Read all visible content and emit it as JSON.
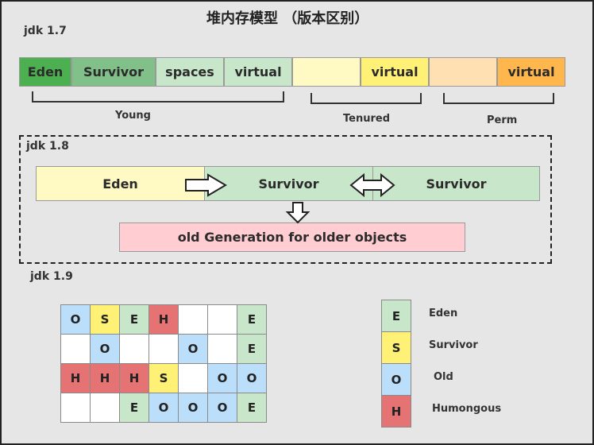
{
  "title": "堆内存模型 （版本区别）",
  "jdk17": {
    "label": "jdk 1.7",
    "segments": [
      {
        "text": "Eden",
        "color": "#4caf50"
      },
      {
        "text": "Survivor",
        "color": "#82c08a"
      },
      {
        "text": "spaces",
        "color": "#c8e6c9"
      },
      {
        "text": "virtual",
        "color": "#c8e6c9"
      },
      {
        "text": "",
        "color": "#fff9c4"
      },
      {
        "text": "virtual",
        "color": "#fff176"
      },
      {
        "text": "",
        "color": "#ffe0b2"
      },
      {
        "text": "virtual",
        "color": "#ffb74d"
      }
    ],
    "groups": [
      "Young",
      "Tenured",
      "Perm"
    ]
  },
  "jdk18": {
    "label": "jdk 1.8",
    "eden": "Eden",
    "survivor1": "Survivor",
    "survivor2": "Survivor",
    "old": "old Generation for older objects"
  },
  "jdk19": {
    "label": "jdk 1.9",
    "grid": [
      [
        "O",
        "S",
        "E",
        "H",
        "",
        "",
        "E"
      ],
      [
        "",
        "O",
        "",
        "",
        "O",
        "",
        "E"
      ],
      [
        "H",
        "H",
        "H",
        "S",
        "",
        "O",
        "O"
      ],
      [
        "",
        "",
        "E",
        "O",
        "O",
        "O",
        "E"
      ]
    ],
    "legend": [
      {
        "letter": "E",
        "name": "Eden"
      },
      {
        "letter": "S",
        "name": "Survivor"
      },
      {
        "letter": "O",
        "name": "Old"
      },
      {
        "letter": "H",
        "name": "Humongous"
      }
    ]
  },
  "colors": {
    "E": "#c8e6c9",
    "S": "#fff176",
    "O": "#bbdefb",
    "H": "#e57373",
    "empty": "#ffffff",
    "eden18": "#fff9c4",
    "survivor18": "#c8e6c9",
    "old18": "#ffcdd2"
  }
}
